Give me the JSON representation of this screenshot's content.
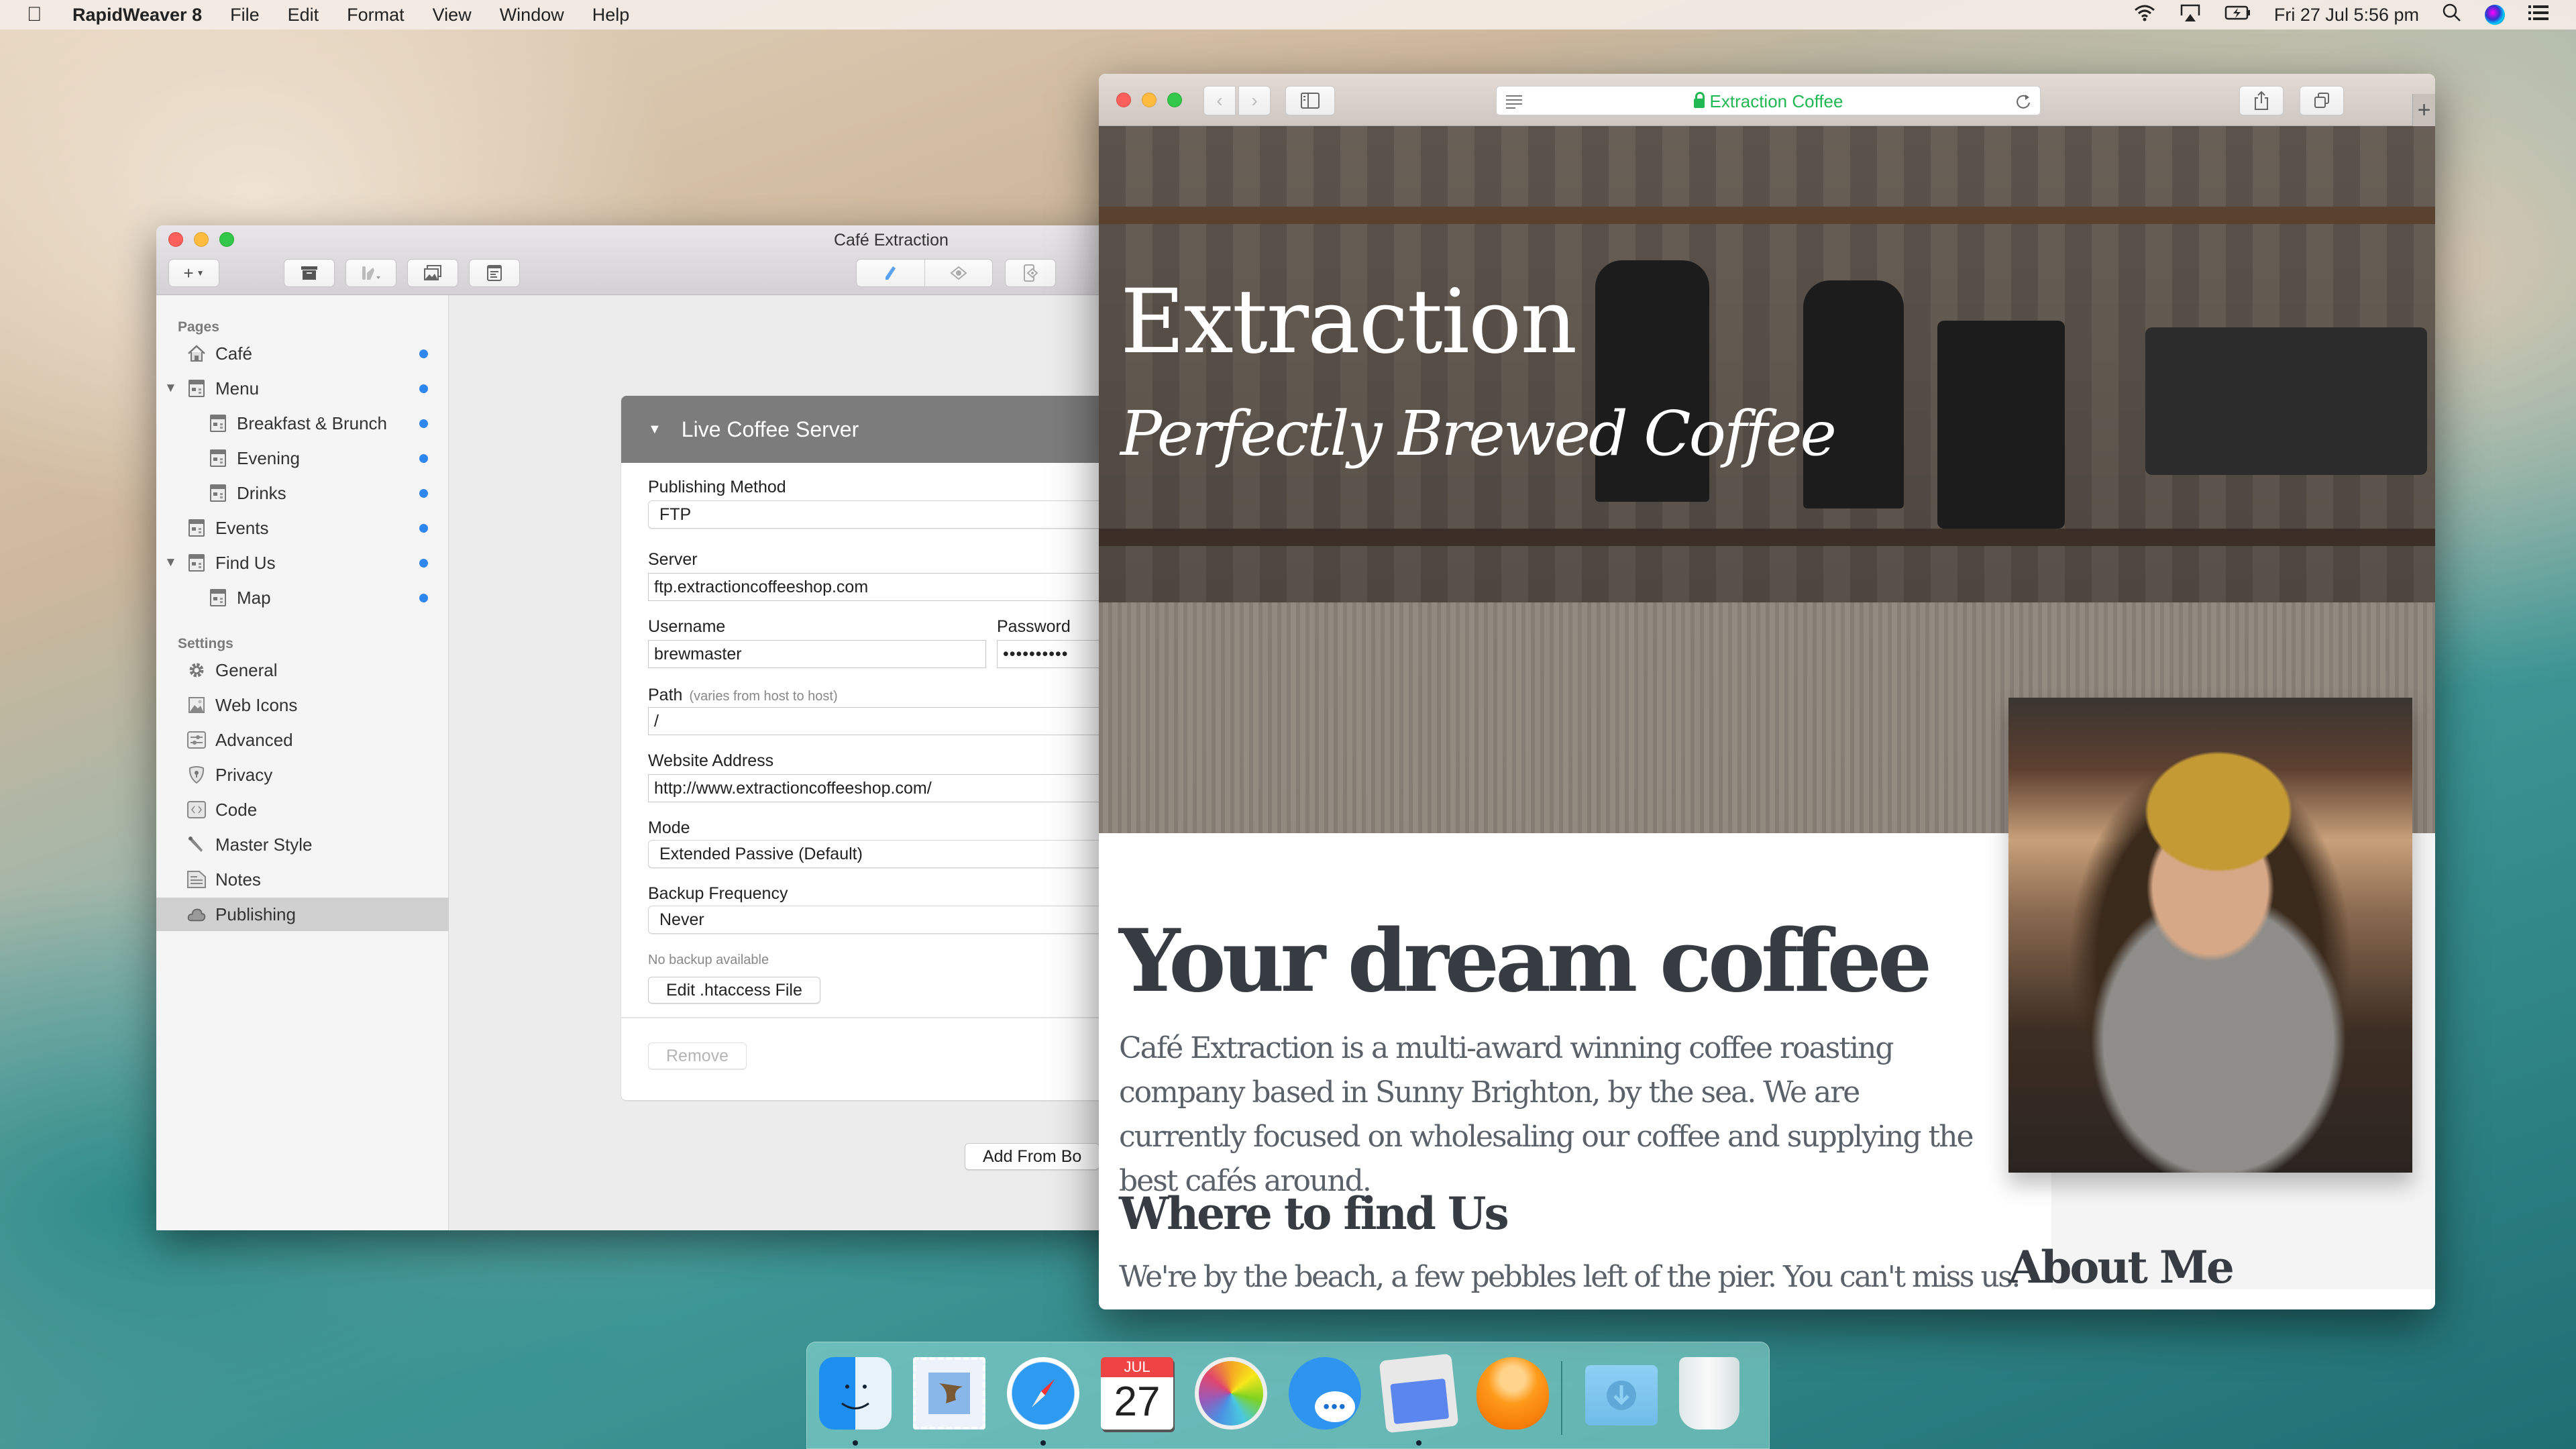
{
  "menubar": {
    "app_name": "RapidWeaver 8",
    "menus": [
      "File",
      "Edit",
      "Format",
      "View",
      "Window",
      "Help"
    ],
    "clock": "Fri 27 Jul  5:56 pm",
    "status_icons": [
      "wifi-icon",
      "airplay-icon",
      "battery-charging-icon",
      "search-icon",
      "siri-icon",
      "notification-center-icon"
    ]
  },
  "rw_window": {
    "title": "Café Extraction",
    "toolbar": {
      "add_button": "+",
      "buttons": [
        "archive-icon",
        "theme-icon",
        "media-icon",
        "page-info-icon"
      ],
      "modes": [
        "edit-pencil-icon",
        "preview-eye-icon",
        "device-preview-icon"
      ]
    },
    "sidebar": {
      "pages_header": "Pages",
      "pages": [
        {
          "label": "Café",
          "icon": "home-icon",
          "level": 0,
          "expandable": false,
          "published_dot": true
        },
        {
          "label": "Menu",
          "icon": "page-icon",
          "level": 0,
          "expandable": true,
          "published_dot": true
        },
        {
          "label": "Breakfast & Brunch",
          "icon": "page-icon",
          "level": 1,
          "expandable": false,
          "published_dot": true
        },
        {
          "label": "Evening",
          "icon": "page-icon",
          "level": 1,
          "expandable": false,
          "published_dot": true
        },
        {
          "label": "Drinks",
          "icon": "page-icon",
          "level": 1,
          "expandable": false,
          "published_dot": true
        },
        {
          "label": "Events",
          "icon": "page-icon",
          "level": 0,
          "expandable": false,
          "published_dot": true
        },
        {
          "label": "Find Us",
          "icon": "page-icon",
          "level": 0,
          "expandable": true,
          "published_dot": true
        },
        {
          "label": "Map",
          "icon": "page-icon",
          "level": 1,
          "expandable": false,
          "published_dot": true
        }
      ],
      "settings_header": "Settings",
      "settings": [
        {
          "label": "General",
          "icon": "gear-icon"
        },
        {
          "label": "Web Icons",
          "icon": "image-icon"
        },
        {
          "label": "Advanced",
          "icon": "sliders-icon"
        },
        {
          "label": "Privacy",
          "icon": "shield-icon"
        },
        {
          "label": "Code",
          "icon": "code-icon"
        },
        {
          "label": "Master Style",
          "icon": "eyedropper-icon"
        },
        {
          "label": "Notes",
          "icon": "note-icon"
        },
        {
          "label": "Publishing",
          "icon": "cloud-icon",
          "selected": true
        }
      ]
    },
    "publishing": {
      "destination_name": "Live Coffee Server",
      "method_label": "Publishing Method",
      "method_value": "FTP",
      "server_label": "Server",
      "server_value": "ftp.extractioncoffeeshop.com",
      "username_label": "Username",
      "username_value": "brewmaster",
      "password_label": "Password",
      "password_value": "••••••••••",
      "path_label": "Path",
      "path_hint": "(varies from host to host)",
      "path_value": "/",
      "website_label": "Website Address",
      "website_value": "http://www.extractioncoffeeshop.com/",
      "mode_label": "Mode",
      "mode_value": "Extended Passive (Default)",
      "backup_label": "Backup Frequency",
      "backup_value": "Never",
      "backup_status": "No backup available",
      "htaccess_button": "Edit .htaccess File",
      "remove_button": "Remove",
      "add_from_button": "Add From Bo"
    }
  },
  "safari": {
    "url_title": "Extraction Coffee",
    "secure": true,
    "accent_color": "#1fb852",
    "new_tab": "+",
    "page": {
      "hero_title": "Extraction",
      "hero_subtitle": "Perfectly Brewed Coffee",
      "heading": "Your dream coffee",
      "intro": "Café Extraction is a multi-award winning coffee roasting company based in Sunny Brighton, by the sea. We are currently focused on wholesaling our coffee and supplying the best cafés around.",
      "find_heading": "Where to find Us",
      "find_text": "We're by the beach, a few pebbles left of the pier. You can't miss us.",
      "about_heading": "About Me"
    }
  },
  "dock": {
    "apps": [
      {
        "name": "Finder",
        "icon": "finder-icon",
        "running": true
      },
      {
        "name": "Mail",
        "icon": "mail-icon",
        "running": false
      },
      {
        "name": "Safari",
        "icon": "safari-icon",
        "running": true
      },
      {
        "name": "Calendar",
        "icon": "calendar-icon",
        "running": false,
        "month": "JUL",
        "day": "27"
      },
      {
        "name": "Photos",
        "icon": "photos-icon",
        "running": false
      },
      {
        "name": "Messages",
        "icon": "messages-icon",
        "running": false
      },
      {
        "name": "RapidWeaver",
        "icon": "rapidweaver-icon",
        "running": true
      },
      {
        "name": "Squash",
        "icon": "orange-app-icon",
        "running": false
      },
      {
        "name": "Downloads",
        "icon": "downloads-folder-icon",
        "running": false
      },
      {
        "name": "Trash",
        "icon": "trash-icon",
        "running": false
      }
    ]
  }
}
